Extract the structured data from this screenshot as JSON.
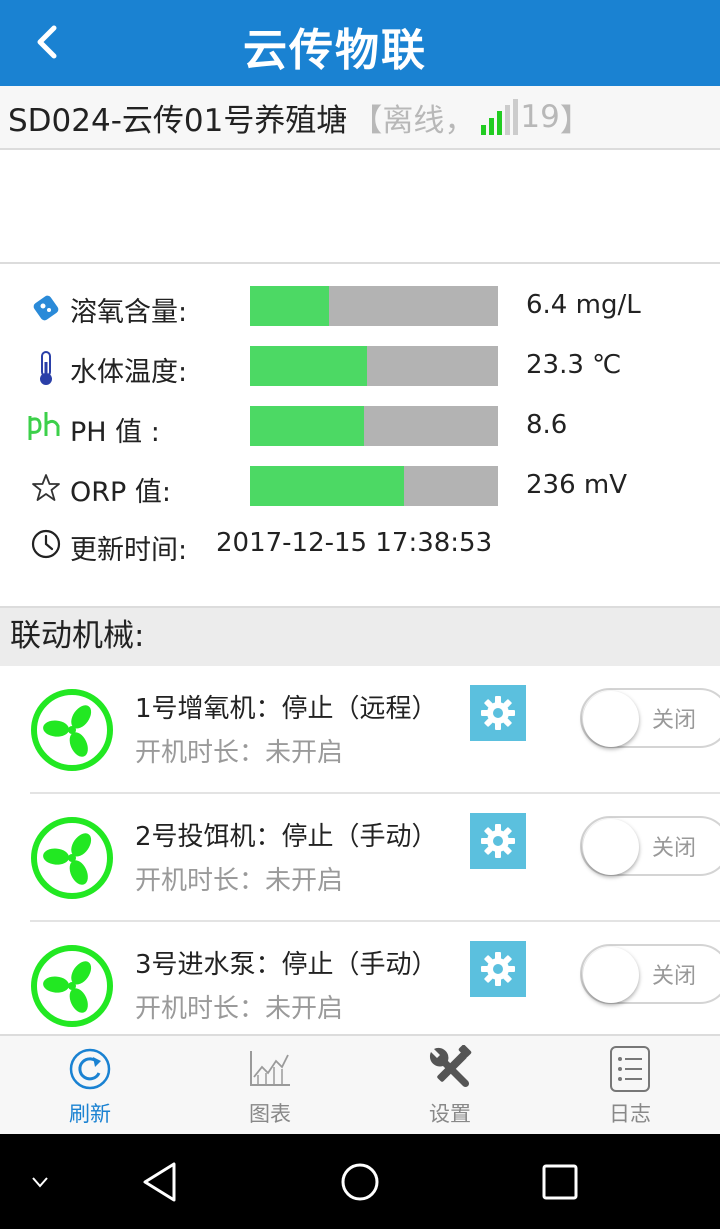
{
  "header": {
    "title": "云传物联"
  },
  "pond": {
    "name": "SD024-云传01号养殖塘",
    "status_prefix": "【离线，",
    "signal_strength": "19",
    "status_suffix": "】"
  },
  "sensors": [
    {
      "icon": "dissolved-oxygen-icon",
      "label": "溶氧含量:",
      "value": "6.4 mg/L",
      "level": 0.32
    },
    {
      "icon": "thermometer-icon",
      "label": "水体温度:",
      "value": "23.3 ℃",
      "level": 0.47
    },
    {
      "icon": "ph-icon",
      "label": "PH 值 :",
      "value": "8.6",
      "level": 0.46
    },
    {
      "icon": "star-icon",
      "label": "ORP 值:",
      "value": "236 mV",
      "level": 0.62
    }
  ],
  "update": {
    "label": "更新时间:",
    "value": "2017-12-15 17:38:53"
  },
  "section": {
    "title": "联动机械:"
  },
  "devices": [
    {
      "name": "1号增氧机：停止（远程）",
      "runtime": "开机时长：未开启",
      "toggle_label": "关闭"
    },
    {
      "name": "2号投饵机：停止（手动）",
      "runtime": "开机时长：未开启",
      "toggle_label": "关闭"
    },
    {
      "name": "3号进水泵：停止（手动）",
      "runtime": "开机时长：未开启",
      "toggle_label": "关闭"
    }
  ],
  "tabs": [
    {
      "label": "刷新",
      "icon": "refresh-icon",
      "active": true
    },
    {
      "label": "图表",
      "icon": "chart-icon",
      "active": false
    },
    {
      "label": "设置",
      "icon": "tools-icon",
      "active": false
    },
    {
      "label": "日志",
      "icon": "log-icon",
      "active": false
    }
  ],
  "colors": {
    "header": "#1a82d2",
    "bar_fill": "#4cd964",
    "bar_track": "#b3b3b3",
    "fan": "#22e822",
    "gear_button": "#5bc0de",
    "signal_on": "#22cc22",
    "signal_off": "#cccccc"
  }
}
